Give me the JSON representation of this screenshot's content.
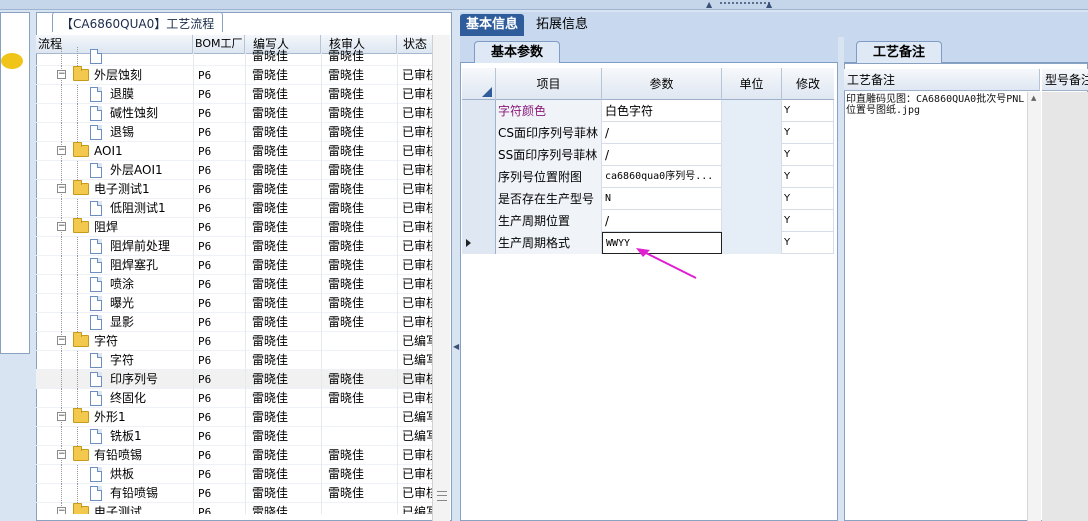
{
  "tree": {
    "tab_title": "【CA6860QUA0】工艺流程",
    "columns": [
      "流程",
      "BOM工厂",
      "编写人",
      "核审人",
      "状态"
    ],
    "rows": [
      {
        "name": "",
        "bom": "",
        "writer": "雷晓佳",
        "reviewer": "雷晓佳",
        "status": "",
        "level": 2,
        "kind": "doc",
        "partial": true
      },
      {
        "name": "外层蚀刻",
        "bom": "P6",
        "writer": "雷晓佳",
        "reviewer": "雷晓佳",
        "status": "已审核",
        "level": 1,
        "kind": "folder"
      },
      {
        "name": "退膜",
        "bom": "P6",
        "writer": "雷晓佳",
        "reviewer": "雷晓佳",
        "status": "已审核",
        "level": 2,
        "kind": "doc"
      },
      {
        "name": "碱性蚀刻",
        "bom": "P6",
        "writer": "雷晓佳",
        "reviewer": "雷晓佳",
        "status": "已审核",
        "level": 2,
        "kind": "doc"
      },
      {
        "name": "退锡",
        "bom": "P6",
        "writer": "雷晓佳",
        "reviewer": "雷晓佳",
        "status": "已审核",
        "level": 2,
        "kind": "doc"
      },
      {
        "name": "AOI1",
        "bom": "P6",
        "writer": "雷晓佳",
        "reviewer": "雷晓佳",
        "status": "已审核",
        "level": 1,
        "kind": "folder"
      },
      {
        "name": "外层AOI1",
        "bom": "P6",
        "writer": "雷晓佳",
        "reviewer": "雷晓佳",
        "status": "已审核",
        "level": 2,
        "kind": "doc"
      },
      {
        "name": "电子测试1",
        "bom": "P6",
        "writer": "雷晓佳",
        "reviewer": "雷晓佳",
        "status": "已审核",
        "level": 1,
        "kind": "folder"
      },
      {
        "name": "低阻测试1",
        "bom": "P6",
        "writer": "雷晓佳",
        "reviewer": "雷晓佳",
        "status": "已审核",
        "level": 2,
        "kind": "doc"
      },
      {
        "name": "阻焊",
        "bom": "P6",
        "writer": "雷晓佳",
        "reviewer": "雷晓佳",
        "status": "已审核",
        "level": 1,
        "kind": "folder"
      },
      {
        "name": "阻焊前处理",
        "bom": "P6",
        "writer": "雷晓佳",
        "reviewer": "雷晓佳",
        "status": "已审核",
        "level": 2,
        "kind": "doc"
      },
      {
        "name": "阻焊塞孔",
        "bom": "P6",
        "writer": "雷晓佳",
        "reviewer": "雷晓佳",
        "status": "已审核",
        "level": 2,
        "kind": "doc"
      },
      {
        "name": "喷涂",
        "bom": "P6",
        "writer": "雷晓佳",
        "reviewer": "雷晓佳",
        "status": "已审核",
        "level": 2,
        "kind": "doc"
      },
      {
        "name": "曝光",
        "bom": "P6",
        "writer": "雷晓佳",
        "reviewer": "雷晓佳",
        "status": "已审核",
        "level": 2,
        "kind": "doc"
      },
      {
        "name": "显影",
        "bom": "P6",
        "writer": "雷晓佳",
        "reviewer": "雷晓佳",
        "status": "已审核",
        "level": 2,
        "kind": "doc"
      },
      {
        "name": "字符",
        "bom": "P6",
        "writer": "雷晓佳",
        "reviewer": "",
        "status": "已编写",
        "level": 1,
        "kind": "folder"
      },
      {
        "name": "字符",
        "bom": "P6",
        "writer": "雷晓佳",
        "reviewer": "",
        "status": "已编写",
        "level": 2,
        "kind": "doc"
      },
      {
        "name": "印序列号",
        "bom": "P6",
        "writer": "雷晓佳",
        "reviewer": "雷晓佳",
        "status": "已审核",
        "level": 2,
        "kind": "doc",
        "selected": true
      },
      {
        "name": "终固化",
        "bom": "P6",
        "writer": "雷晓佳",
        "reviewer": "雷晓佳",
        "status": "已审核",
        "level": 2,
        "kind": "doc"
      },
      {
        "name": "外形1",
        "bom": "P6",
        "writer": "雷晓佳",
        "reviewer": "",
        "status": "已编写",
        "level": 1,
        "kind": "folder"
      },
      {
        "name": "铣板1",
        "bom": "P6",
        "writer": "雷晓佳",
        "reviewer": "",
        "status": "已编写",
        "level": 2,
        "kind": "doc"
      },
      {
        "name": "有铅喷锡",
        "bom": "P6",
        "writer": "雷晓佳",
        "reviewer": "雷晓佳",
        "status": "已审核",
        "level": 1,
        "kind": "folder"
      },
      {
        "name": "烘板",
        "bom": "P6",
        "writer": "雷晓佳",
        "reviewer": "雷晓佳",
        "status": "已审核",
        "level": 2,
        "kind": "doc"
      },
      {
        "name": "有铅喷锡",
        "bom": "P6",
        "writer": "雷晓佳",
        "reviewer": "雷晓佳",
        "status": "已审核",
        "level": 2,
        "kind": "doc"
      },
      {
        "name": "电子测试",
        "bom": "P6",
        "writer": "雷晓佳",
        "reviewer": "",
        "status": "已编写",
        "level": 1,
        "kind": "folder"
      },
      {
        "name": "",
        "bom": "",
        "writer": "",
        "reviewer": "",
        "status": "",
        "level": 2,
        "kind": "doc",
        "partial": true
      }
    ]
  },
  "main_tabs": [
    "基本信息",
    "拓展信息"
  ],
  "basic_params": {
    "tab_label": "基本参数",
    "columns": [
      "项目",
      "参数",
      "单位",
      "修改"
    ],
    "rows": [
      {
        "item": "字符颜色",
        "param": "白色字符",
        "unit": "",
        "modified": "Y",
        "highlight": true
      },
      {
        "item": "CS面印序列号菲林",
        "param": "/",
        "unit": "",
        "modified": "Y"
      },
      {
        "item": "SS面印序列号菲林",
        "param": "/",
        "unit": "",
        "modified": "Y"
      },
      {
        "item": "序列号位置附图",
        "param": "ca6860qua0序列号...",
        "unit": "",
        "modified": "Y"
      },
      {
        "item": "是否存在生产型号",
        "param": "N",
        "unit": "",
        "modified": "Y"
      },
      {
        "item": "生产周期位置",
        "param": "/",
        "unit": "",
        "modified": "Y"
      },
      {
        "item": "生产周期格式",
        "param": "WWYY",
        "unit": "",
        "modified": "Y",
        "current": true
      }
    ]
  },
  "remarks": {
    "tab_label": "工艺备注",
    "col1": "工艺备注",
    "col2": "型号备注",
    "text": "印直雕码见图：CA6860QUA0批次号PNL位置号图纸.jpg"
  },
  "colors": {
    "accent": "#2f5d9b",
    "highlight_text": "#8b1a7a",
    "annotation_arrow": "#e020d0"
  }
}
